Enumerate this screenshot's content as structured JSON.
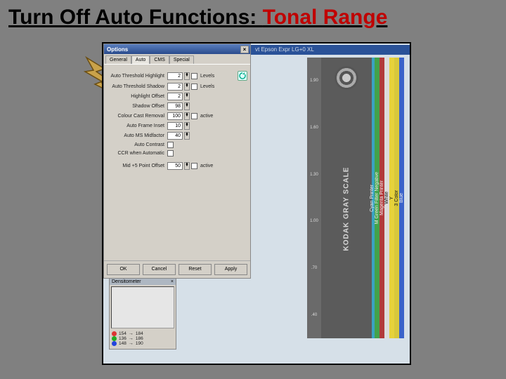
{
  "slide": {
    "title_black": "Turn Off Auto Functions: ",
    "title_red": "Tonal Range"
  },
  "scanner_title": "vt Epson Expr LG+0 XL",
  "dialog": {
    "title": "Options",
    "tabs": [
      "General",
      "Auto",
      "CMS",
      "Special"
    ],
    "active_tab": 1,
    "rows": {
      "auto_thresh_hl": {
        "label": "Auto Threshold Highlight",
        "value": "2",
        "chk_label": "Levels"
      },
      "auto_thresh_sh": {
        "label": "Auto Threshold Shadow",
        "value": "2",
        "chk_label": "Levels"
      },
      "hl_offset": {
        "label": "Highlight Offset",
        "value": "2"
      },
      "sh_offset": {
        "label": "Shadow Offset",
        "value": "98"
      },
      "ccr": {
        "label": "Colour Cast Removal",
        "value": "100",
        "chk_label": "active"
      },
      "auto_frame": {
        "label": "Auto Frame Inset",
        "value": "10"
      },
      "auto_ms": {
        "label": "Auto MS Midfactor",
        "value": "40"
      },
      "auto_contrast": {
        "label": "Auto Contrast"
      },
      "ccr_auto": {
        "label": "CCR when Automatic"
      },
      "midpip": {
        "label": "Mid +5 Point Offset",
        "value": "50",
        "chk_label": "active"
      }
    },
    "buttons": {
      "ok": "OK",
      "cancel": "Cancel",
      "reset": "Reset",
      "apply": "Apply"
    }
  },
  "densitometer": {
    "title": "Densitometer",
    "r": {
      "in": "154",
      "out": "184"
    },
    "g": {
      "in": "136",
      "out": "186"
    },
    "b": {
      "in": "148",
      "out": "190"
    }
  },
  "preview": {
    "grayscale": "KODAK GRAY SCALE",
    "ticks": [
      "1.90",
      "",
      "1.60",
      "",
      "1.30",
      "",
      "1.00",
      "",
      ".70",
      "",
      ".40"
    ],
    "colors": [
      {
        "name": "Blue",
        "bg": "#3b63c9"
      },
      {
        "name": "3 Color",
        "bg": "#d8c83c"
      },
      {
        "name": "Y",
        "bg": "#e6d23a"
      },
      {
        "name": "White",
        "bg": "#dcdcdc"
      },
      {
        "name": "Magenta Printer",
        "bg": "#b13b3b"
      },
      {
        "name": "M   Green Filter Negative",
        "bg": "#43a24a"
      },
      {
        "name": "Cyan Printer",
        "bg": "#3aa3c2"
      }
    ]
  }
}
